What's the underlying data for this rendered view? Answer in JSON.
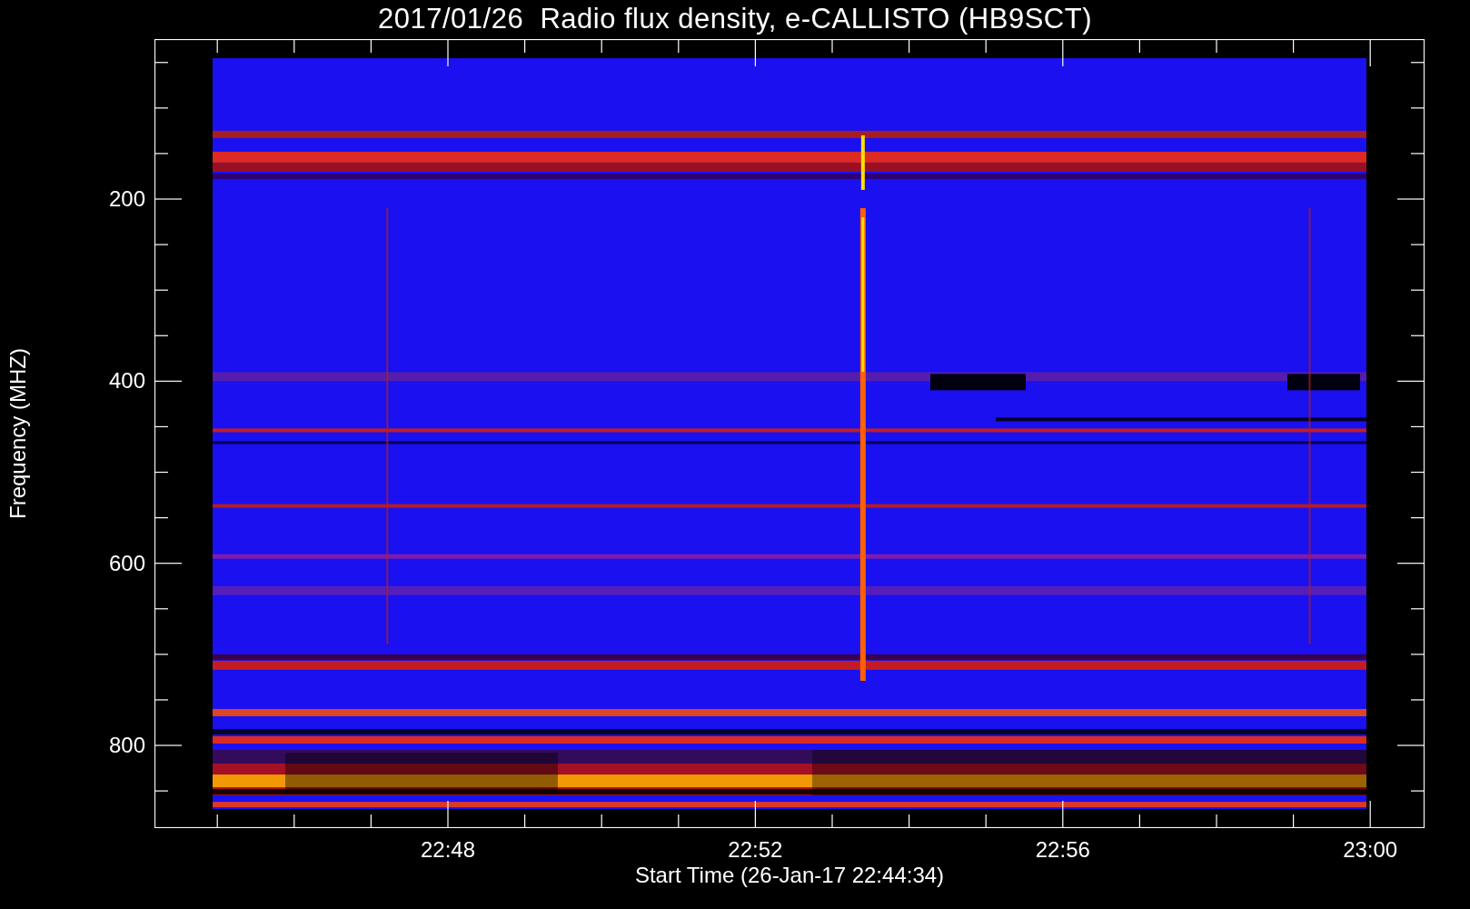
{
  "title": "2017/01/26  Radio flux density, e-CALLISTO (HB9SCT)",
  "y_axis": {
    "label": "Frequency (MHZ)",
    "ticks": [
      "200",
      "400",
      "600",
      "800"
    ]
  },
  "x_axis": {
    "label": "Start Time (26-Jan-17 22:44:34)",
    "ticks": [
      "22:48",
      "22:52",
      "22:56",
      "23:00"
    ]
  }
}
